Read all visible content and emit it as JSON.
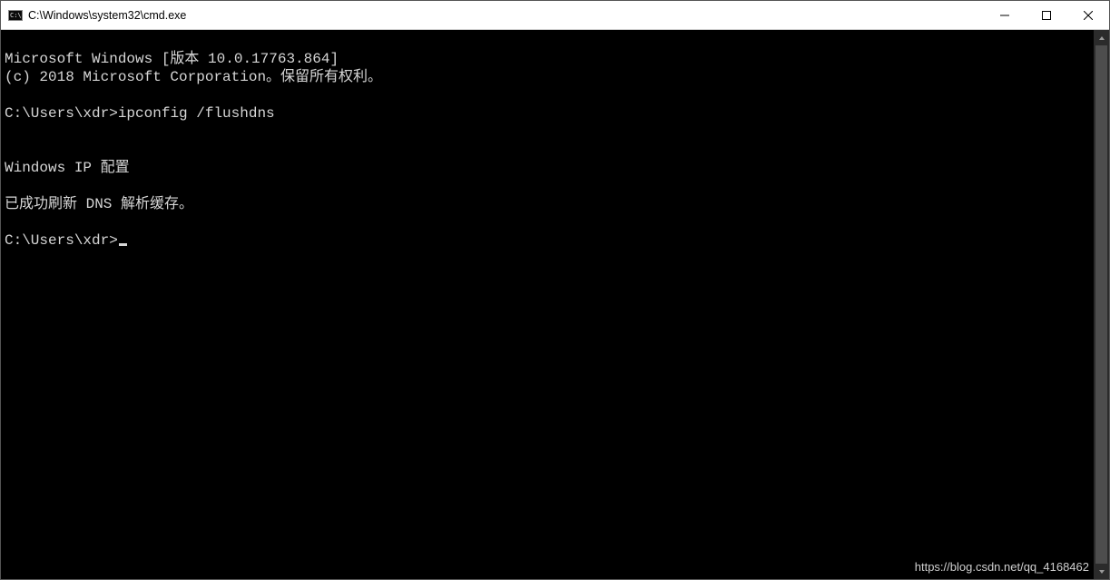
{
  "titlebar": {
    "title": "C:\\Windows\\system32\\cmd.exe"
  },
  "console": {
    "line1": "Microsoft Windows [版本 10.0.17763.864]",
    "line2": "(c) 2018 Microsoft Corporation。保留所有权利。",
    "prompt1": "C:\\Users\\xdr>",
    "command1": "ipconfig /flushdns",
    "line3": "Windows IP 配置",
    "line4": "已成功刷新 DNS 解析缓存。",
    "prompt2": "C:\\Users\\xdr>"
  },
  "watermark": "https://blog.csdn.net/qq_4168462"
}
